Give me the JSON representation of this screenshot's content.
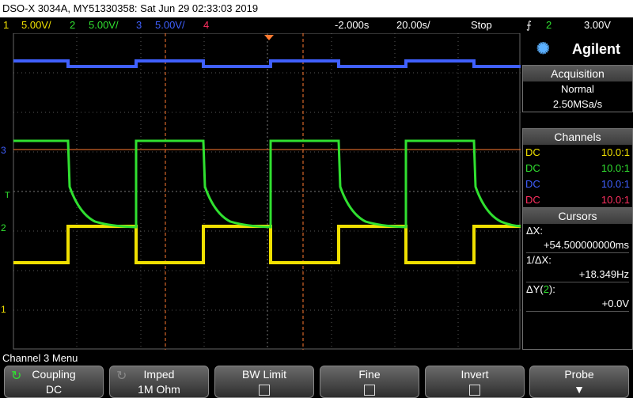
{
  "title": "DSO-X 3034A, MY51330358: Sat Jun 29 02:33:03 2019",
  "status": {
    "ch1_num": "1",
    "ch1_scale": "5.00V/",
    "ch2_num": "2",
    "ch2_scale": "5.00V/",
    "ch3_num": "3",
    "ch3_scale": "5.00V/",
    "ch4_num": "4",
    "delay": "-2.000s",
    "timebase": "20.00s/",
    "run_state": "Stop",
    "trigger_source": "2",
    "trigger_level": "3.00V"
  },
  "colors": {
    "ch1": "#f0e000",
    "ch2": "#30e030",
    "ch3": "#4060ff",
    "ch4": "#ff3060",
    "cursor": "#ff7a30"
  },
  "grid_markers": {
    "ch3": "3",
    "ch2": "2",
    "ch1": "1",
    "trig": "T"
  },
  "panel": {
    "brand": "Agilent",
    "acquisition": {
      "header": "Acquisition",
      "mode": "Normal",
      "rate": "2.50MSa/s"
    },
    "channels": {
      "header": "Channels",
      "rows": [
        {
          "coupling": "DC",
          "probe": "10.0:1"
        },
        {
          "coupling": "DC",
          "probe": "10.0:1"
        },
        {
          "coupling": "DC",
          "probe": "10.0:1"
        },
        {
          "coupling": "DC",
          "probe": "10.0:1"
        }
      ]
    },
    "cursors": {
      "header": "Cursors",
      "dx_label": "ΔX:",
      "dx_value": "+54.500000000ms",
      "inv_label": "1/ΔX:",
      "inv_value": "+18.349Hz",
      "dy_label_pre": "ΔY(",
      "dy_label_ch": "2",
      "dy_label_post": "):",
      "dy_value": "+0.0V"
    }
  },
  "menu_title": "Channel 3 Menu",
  "softkeys": [
    {
      "title": "Coupling",
      "value": "DC"
    },
    {
      "title": "Imped",
      "value": "1M Ohm"
    },
    {
      "title": "BW Limit",
      "value": ""
    },
    {
      "title": "Fine",
      "value": ""
    },
    {
      "title": "Invert",
      "value": ""
    },
    {
      "title": "Probe",
      "value": ""
    }
  ]
}
